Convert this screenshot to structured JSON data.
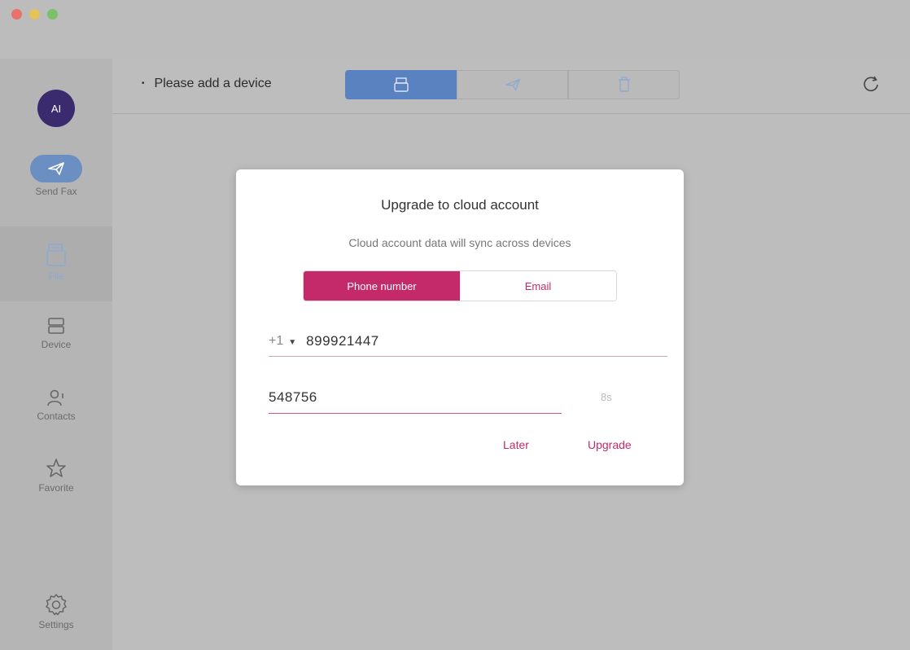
{
  "sidebar": {
    "avatar_initials": "AI",
    "items": [
      {
        "label": "Send Fax",
        "icon": "paper-plane-icon"
      },
      {
        "label": "File",
        "icon": "fax-file-icon"
      },
      {
        "label": "Device",
        "icon": "device-icon"
      },
      {
        "label": "Contacts",
        "icon": "contacts-icon"
      },
      {
        "label": "Favorite",
        "icon": "star-icon"
      },
      {
        "label": "Settings",
        "icon": "gear-icon"
      }
    ]
  },
  "topbar": {
    "device_label": "Please add a device",
    "segments": [
      "fax-icon",
      "paper-plane-icon",
      "trash-icon"
    ],
    "refresh_icon": "refresh-icon"
  },
  "modal": {
    "title": "Upgrade to cloud account",
    "subtitle": "Cloud account data will sync across devices",
    "tabs": {
      "phone": "Phone number",
      "email": "Email"
    },
    "country_code": "+1",
    "phone_value": "899921447",
    "code_value": "548756",
    "countdown": "8s",
    "later_label": "Later",
    "upgrade_label": "Upgrade"
  },
  "colors": {
    "accent": "#c42a6a",
    "active_blue": "#5b82c0",
    "avatar": "#3a2a6e"
  }
}
